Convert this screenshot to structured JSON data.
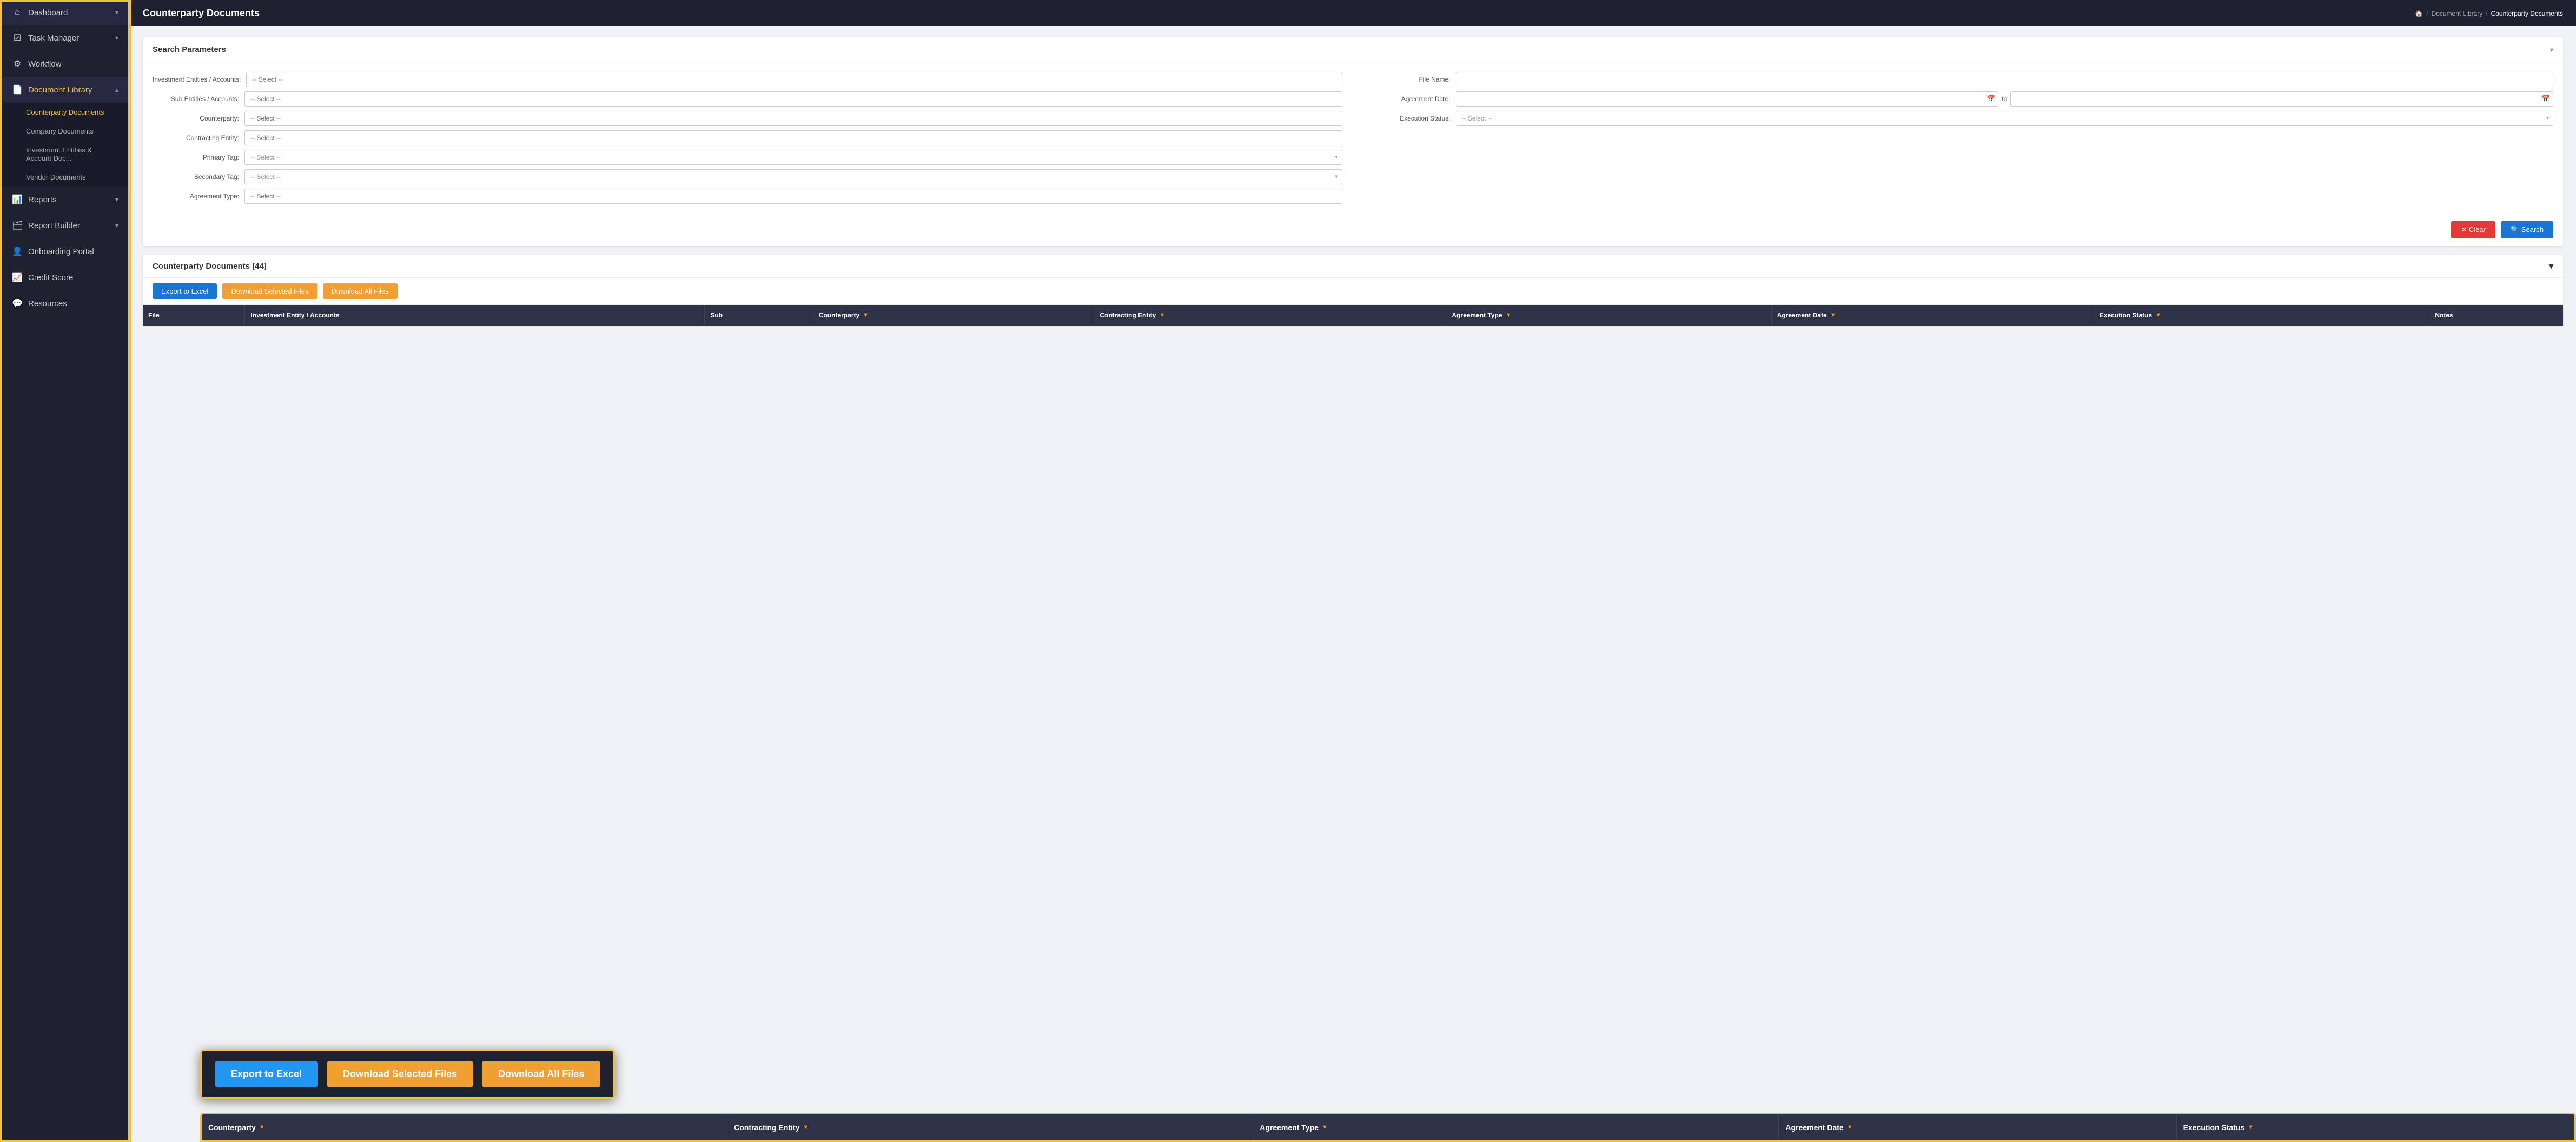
{
  "sidebar": {
    "items": [
      {
        "id": "dashboard",
        "label": "Dashboard",
        "icon": "⌂",
        "hasChevron": true,
        "active": false
      },
      {
        "id": "task-manager",
        "label": "Task Manager",
        "icon": "☑",
        "hasChevron": true,
        "active": false
      },
      {
        "id": "workflow",
        "label": "Workflow",
        "icon": "⚙",
        "hasChevron": false,
        "active": false
      },
      {
        "id": "document-library",
        "label": "Document Library",
        "icon": "📄",
        "hasChevron": true,
        "active": true
      },
      {
        "id": "reports",
        "label": "Reports",
        "icon": "📊",
        "hasChevron": true,
        "active": false
      },
      {
        "id": "report-builder",
        "label": "Report Builder",
        "icon": "🗂",
        "hasChevron": true,
        "active": false
      },
      {
        "id": "onboarding-portal",
        "label": "Onboarding Portal",
        "icon": "👤",
        "hasChevron": false,
        "active": false
      },
      {
        "id": "credit-score",
        "label": "Credit Score",
        "icon": "📈",
        "hasChevron": false,
        "active": false
      },
      {
        "id": "resources",
        "label": "Resources",
        "icon": "💬",
        "hasChevron": false,
        "active": false
      }
    ],
    "submenu": {
      "document-library": [
        {
          "id": "counterparty-documents",
          "label": "Counterparty Documents",
          "active": true
        },
        {
          "id": "company-documents",
          "label": "Company Documents",
          "active": false
        },
        {
          "id": "investment-entities",
          "label": "Investment Entities & Account Doc...",
          "active": false
        },
        {
          "id": "vendor-documents",
          "label": "Vendor Documents",
          "active": false
        }
      ]
    }
  },
  "header": {
    "title": "Counterparty Documents",
    "breadcrumb": {
      "home": "🏠",
      "separator1": "/",
      "library": "Document Library",
      "separator2": "/",
      "current": "Counterparty Documents"
    }
  },
  "search_panel": {
    "title": "Search Parameters",
    "fields": {
      "investment_entities_label": "Investment Entities / Accounts:",
      "investment_entities_placeholder": "-- Select --",
      "sub_entities_label": "Sub Entities / Accounts:",
      "sub_entities_placeholder": "-- Select --",
      "counterparty_label": "Counterparty:",
      "counterparty_placeholder": "-- Select --",
      "contracting_entity_label": "Contracting Entity:",
      "contracting_entity_placeholder": "-- Select --",
      "primary_tag_label": "Primary Tag:",
      "primary_tag_placeholder": "-- Select --",
      "secondary_tag_label": "Secondary Tag:",
      "secondary_tag_placeholder": "-- Select --",
      "agreement_type_label": "Agreement Type:",
      "agreement_type_placeholder": "-- Select --",
      "file_name_label": "File Name:",
      "file_name_placeholder": "",
      "agreement_date_label": "Agreement Date:",
      "agreement_date_to": "to",
      "execution_status_label": "Execution Status:",
      "execution_status_placeholder": "-- Select --"
    },
    "buttons": {
      "clear": "✕ Clear",
      "search": "🔍 Search"
    }
  },
  "results_panel": {
    "title": "Counterparty Documents [44]",
    "toolbar": {
      "export_excel": "Export to Excel",
      "download_selected": "Download Selected Files",
      "download_all": "Download All Files"
    },
    "table_headers": [
      {
        "id": "file",
        "label": "File",
        "filterable": false
      },
      {
        "id": "investment-entity",
        "label": "Investment Entity / Accounts",
        "filterable": false
      },
      {
        "id": "sub",
        "label": "Sub",
        "filterable": false
      },
      {
        "id": "counterparty",
        "label": "Counterparty",
        "filterable": true
      },
      {
        "id": "contracting-entity",
        "label": "Contracting Entity",
        "filterable": true
      },
      {
        "id": "agreement-type",
        "label": "Agreement Type",
        "filterable": true
      },
      {
        "id": "agreement-date",
        "label": "Agreement Date",
        "filterable": true
      },
      {
        "id": "execution-status",
        "label": "Execution Status",
        "filterable": true
      },
      {
        "id": "notes",
        "label": "Notes",
        "filterable": false
      }
    ]
  },
  "highlight_buttons": {
    "export_excel": "Export to Excel",
    "download_selected": "Download Selected Files",
    "download_all": "Download All Files"
  },
  "highlight_table": {
    "headers": [
      {
        "id": "counterparty",
        "label": "Counterparty"
      },
      {
        "id": "contracting-entity",
        "label": "Contracting Entity"
      },
      {
        "id": "agreement-type",
        "label": "Agreement Type"
      },
      {
        "id": "agreement-date",
        "label": "Agreement Date"
      },
      {
        "id": "execution-status",
        "label": "Execution Status"
      }
    ]
  }
}
